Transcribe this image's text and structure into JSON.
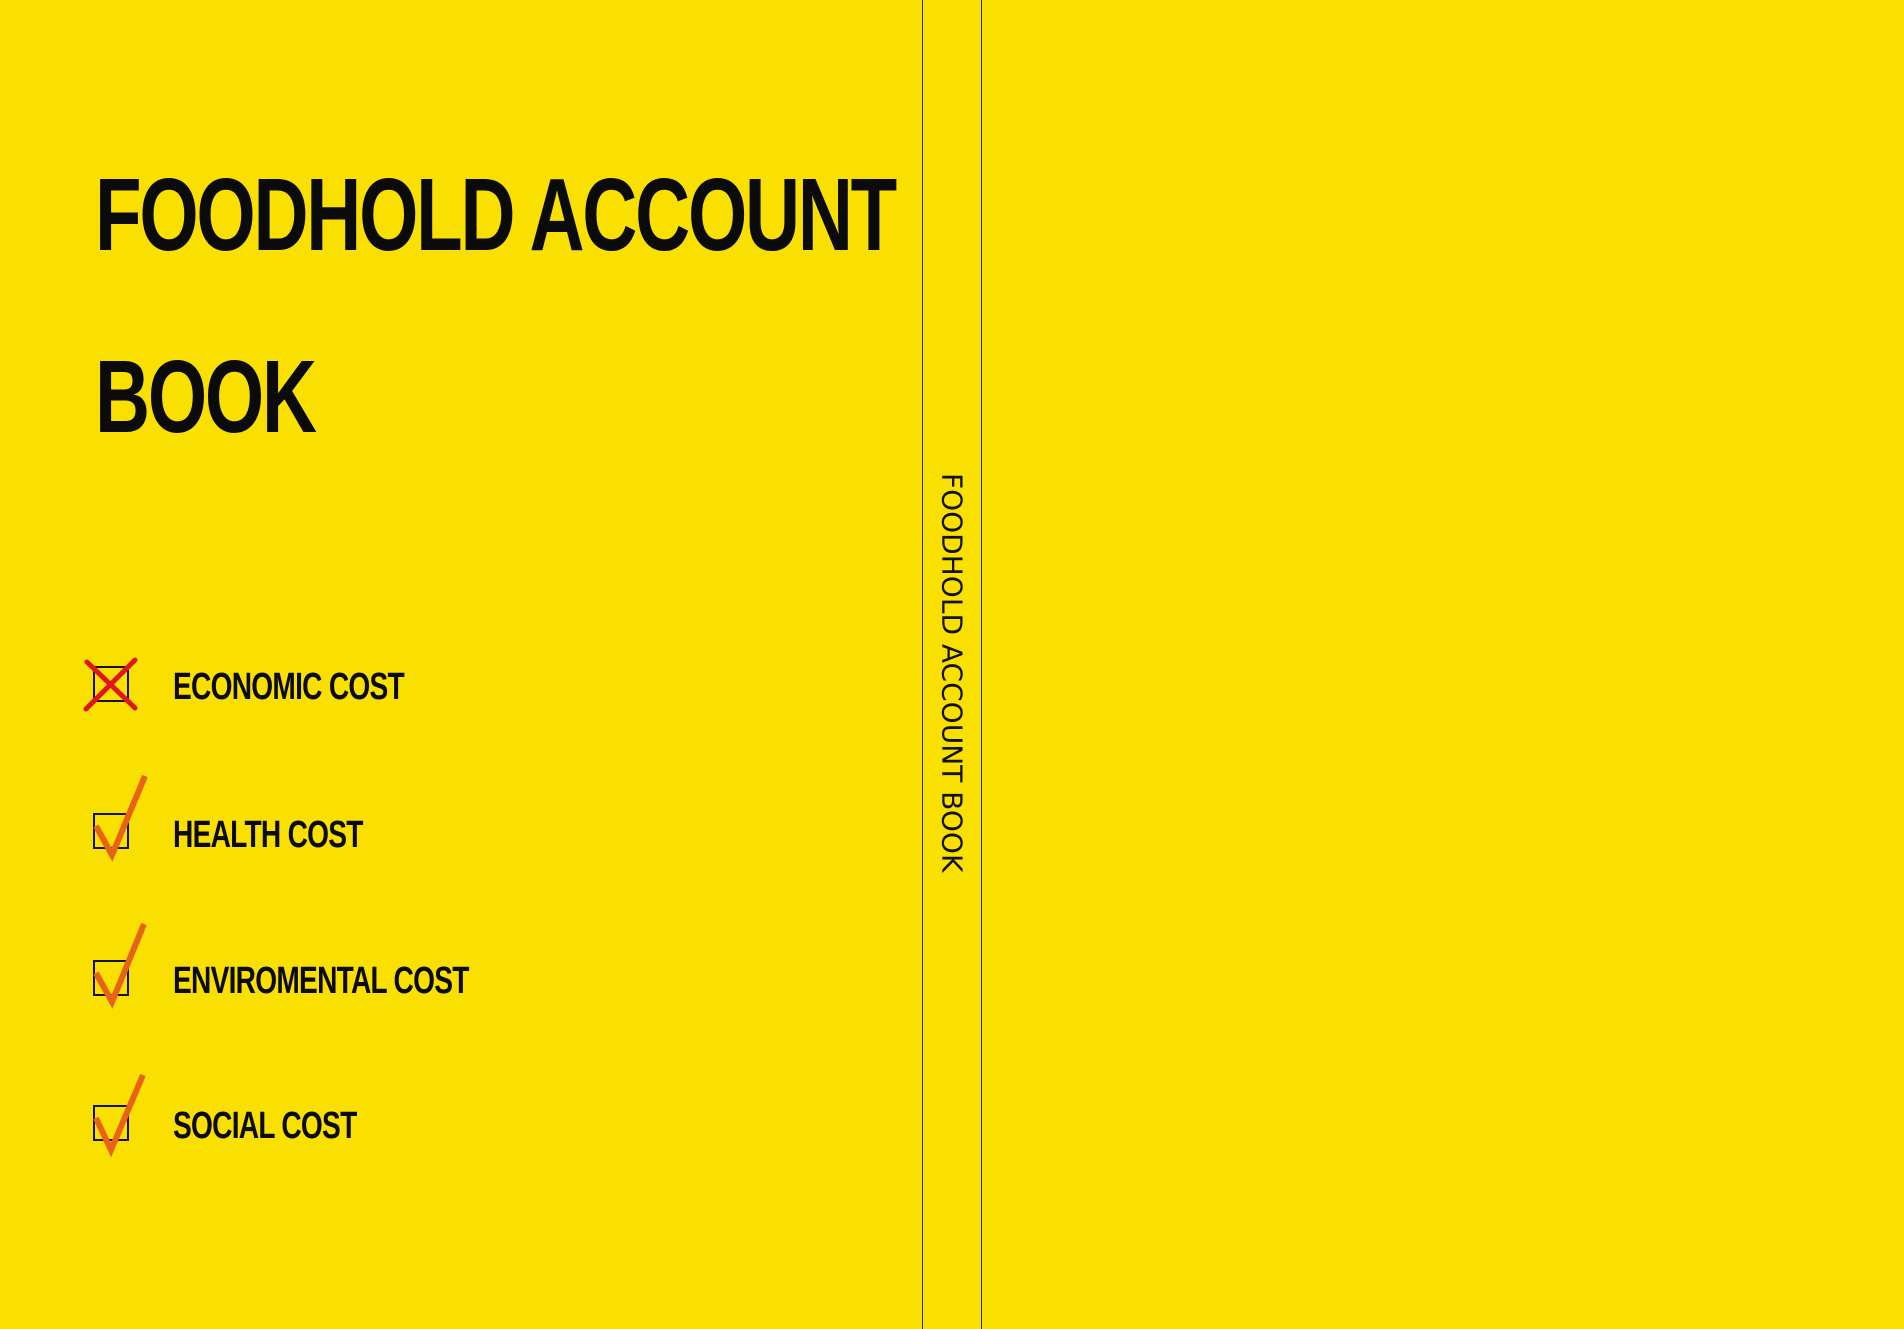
{
  "background_color": "#f9e000",
  "front": {
    "title_line1": "FOODHOLD ACCOUNT",
    "title_line2": "BOOK",
    "items": [
      {
        "label": "ECONOMIC COST",
        "status": "crossed",
        "icon": "red-x-icon",
        "color": "#e0161e"
      },
      {
        "label": "HEALTH COST",
        "status": "checked",
        "icon": "orange-checkmark-icon",
        "color": "#e8621a"
      },
      {
        "label": "ENVIROMENTAL COST",
        "status": "checked",
        "icon": "orange-checkmark-icon",
        "color": "#e8621a"
      },
      {
        "label": "SOCIAL COST",
        "status": "checked",
        "icon": "orange-checkmark-icon",
        "color": "#e8621a"
      }
    ]
  },
  "spine": {
    "text": "FOODHOLD ACCOUNT BOOK"
  }
}
